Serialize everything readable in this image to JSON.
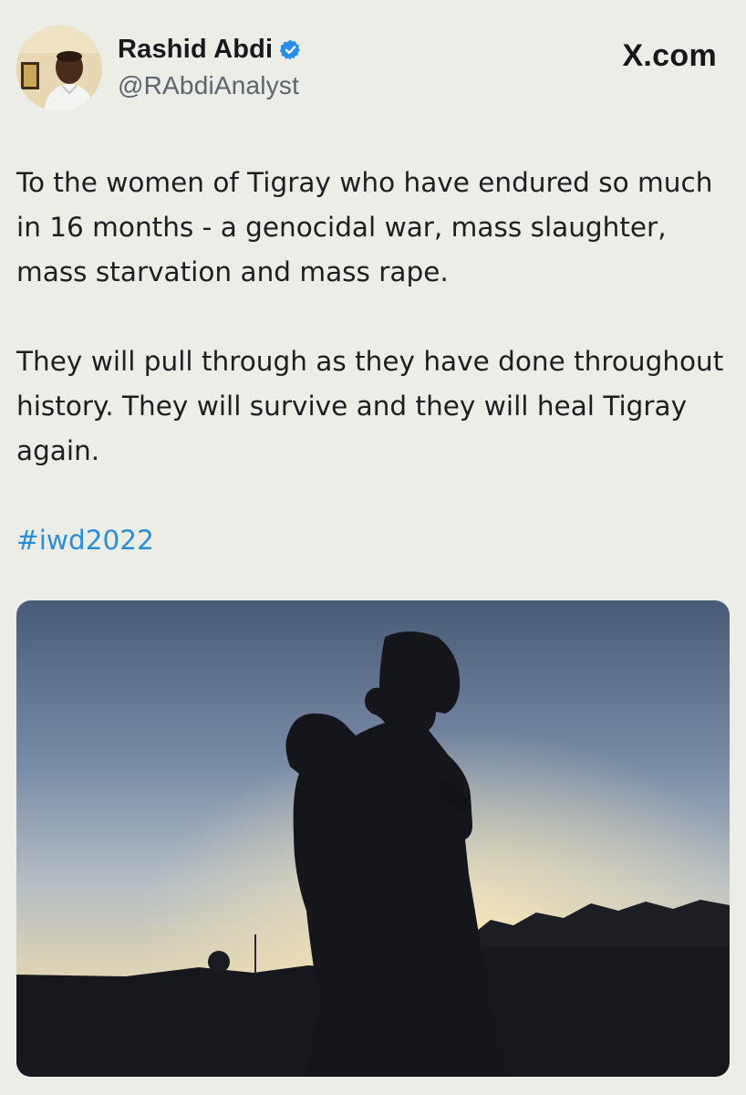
{
  "tweet": {
    "author": {
      "display_name": "Rashid Abdi",
      "handle": "@RAbdiAnalyst",
      "verified_icon": "verified-badge-icon"
    },
    "site_label": "X.com",
    "paragraphs": [
      "To the women of Tigray who have endured so much in 16 months - a genocidal war, mass slaughter, mass starvation and mass rape.",
      "They will pull through as they have done throughout history. They will survive and they will heal Tigray again."
    ],
    "hashtag": "#iwd2022",
    "media": {
      "kind": "photo"
    }
  },
  "colors": {
    "background": "#ecede6",
    "hashtag": "#2d8ed6",
    "verified": "#2a8ee8"
  }
}
